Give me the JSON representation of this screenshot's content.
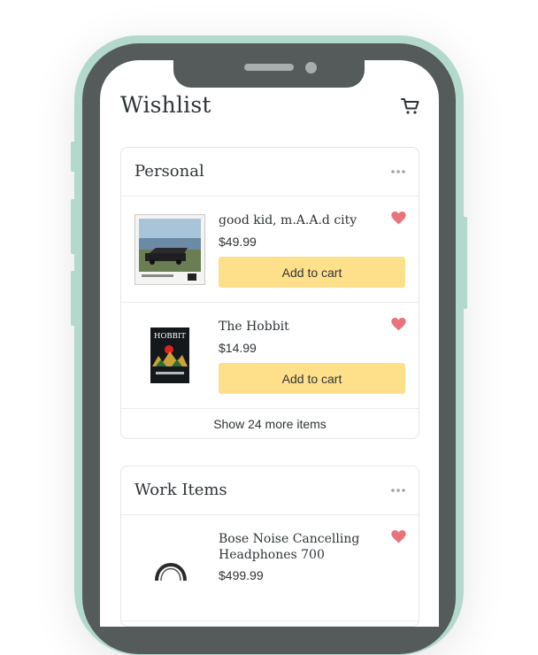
{
  "app": {
    "title": "Wishlist",
    "cart_icon": "shopping-cart-icon"
  },
  "lists": [
    {
      "title": "Personal",
      "more_icon": "more-dots-icon",
      "items": [
        {
          "name": "good kid, m.A.A.d city",
          "price": "$49.99",
          "button": "Add to cart",
          "favorited": true
        },
        {
          "name": "The Hobbit",
          "price": "$14.99",
          "button": "Add to cart",
          "favorited": true
        }
      ],
      "show_more": "Show 24 more items"
    },
    {
      "title": "Work Items",
      "more_icon": "more-dots-icon",
      "items": [
        {
          "name": "Bose Noise Cancelling Headphones 700",
          "price": "$499.99",
          "favorited": true
        }
      ]
    }
  ],
  "colors": {
    "frame": "#b3d8cc",
    "bezel": "#555a5b",
    "button": "#ffe08a",
    "heart": "#e8737c",
    "text": "#2f3437"
  }
}
